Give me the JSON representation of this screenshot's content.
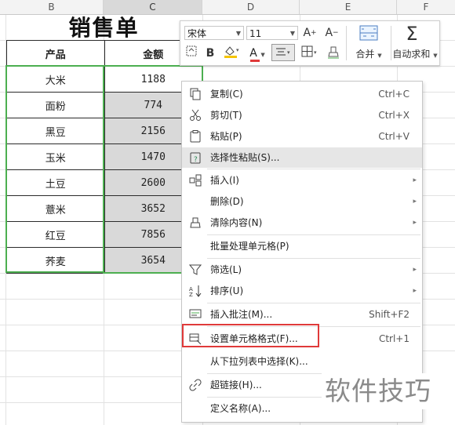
{
  "column_headers": [
    "B",
    "C",
    "D",
    "E",
    "F"
  ],
  "sheet": {
    "title": "销售单",
    "headers": [
      "产品",
      "金额"
    ],
    "rows": [
      [
        "大米",
        "1188"
      ],
      [
        "面粉",
        "774"
      ],
      [
        "黑豆",
        "2156"
      ],
      [
        "玉米",
        "1470"
      ],
      [
        "土豆",
        "2600"
      ],
      [
        "薏米",
        "3652"
      ],
      [
        "红豆",
        "7856"
      ],
      [
        "荞麦",
        "3654"
      ]
    ]
  },
  "mini_toolbar": {
    "font_name": "宋体",
    "font_size": "11",
    "increase_font": "A",
    "decrease_font": "A",
    "bold": "B",
    "font_color_letter": "A",
    "merge_label": "合并",
    "autosum_label": "自动求和"
  },
  "context_menu": {
    "items": [
      {
        "label": "复制(C)",
        "shortcut": "Ctrl+C"
      },
      {
        "label": "剪切(T)",
        "shortcut": "Ctrl+X"
      },
      {
        "label": "粘贴(P)",
        "shortcut": "Ctrl+V"
      },
      {
        "label": "选择性粘贴(S)...",
        "shortcut": ""
      },
      {
        "label": "插入(I)",
        "shortcut": ""
      },
      {
        "label": "删除(D)",
        "shortcut": ""
      },
      {
        "label": "清除内容(N)",
        "shortcut": ""
      },
      {
        "label": "批量处理单元格(P)",
        "shortcut": ""
      },
      {
        "label": "筛选(L)",
        "shortcut": ""
      },
      {
        "label": "排序(U)",
        "shortcut": ""
      },
      {
        "label": "插入批注(M)...",
        "shortcut": "Shift+F2"
      },
      {
        "label": "设置单元格格式(F)...",
        "shortcut": "Ctrl+1"
      },
      {
        "label": "从下拉列表中选择(K)...",
        "shortcut": ""
      },
      {
        "label": "超链接(H)...",
        "shortcut": ""
      },
      {
        "label": "定义名称(A)...",
        "shortcut": ""
      }
    ]
  },
  "watermark": "软件技巧",
  "colors": {
    "selection_border": "#4caf50",
    "highlight_box": "#e03a3a",
    "selected_cell_fill": "#d9d9d9"
  }
}
